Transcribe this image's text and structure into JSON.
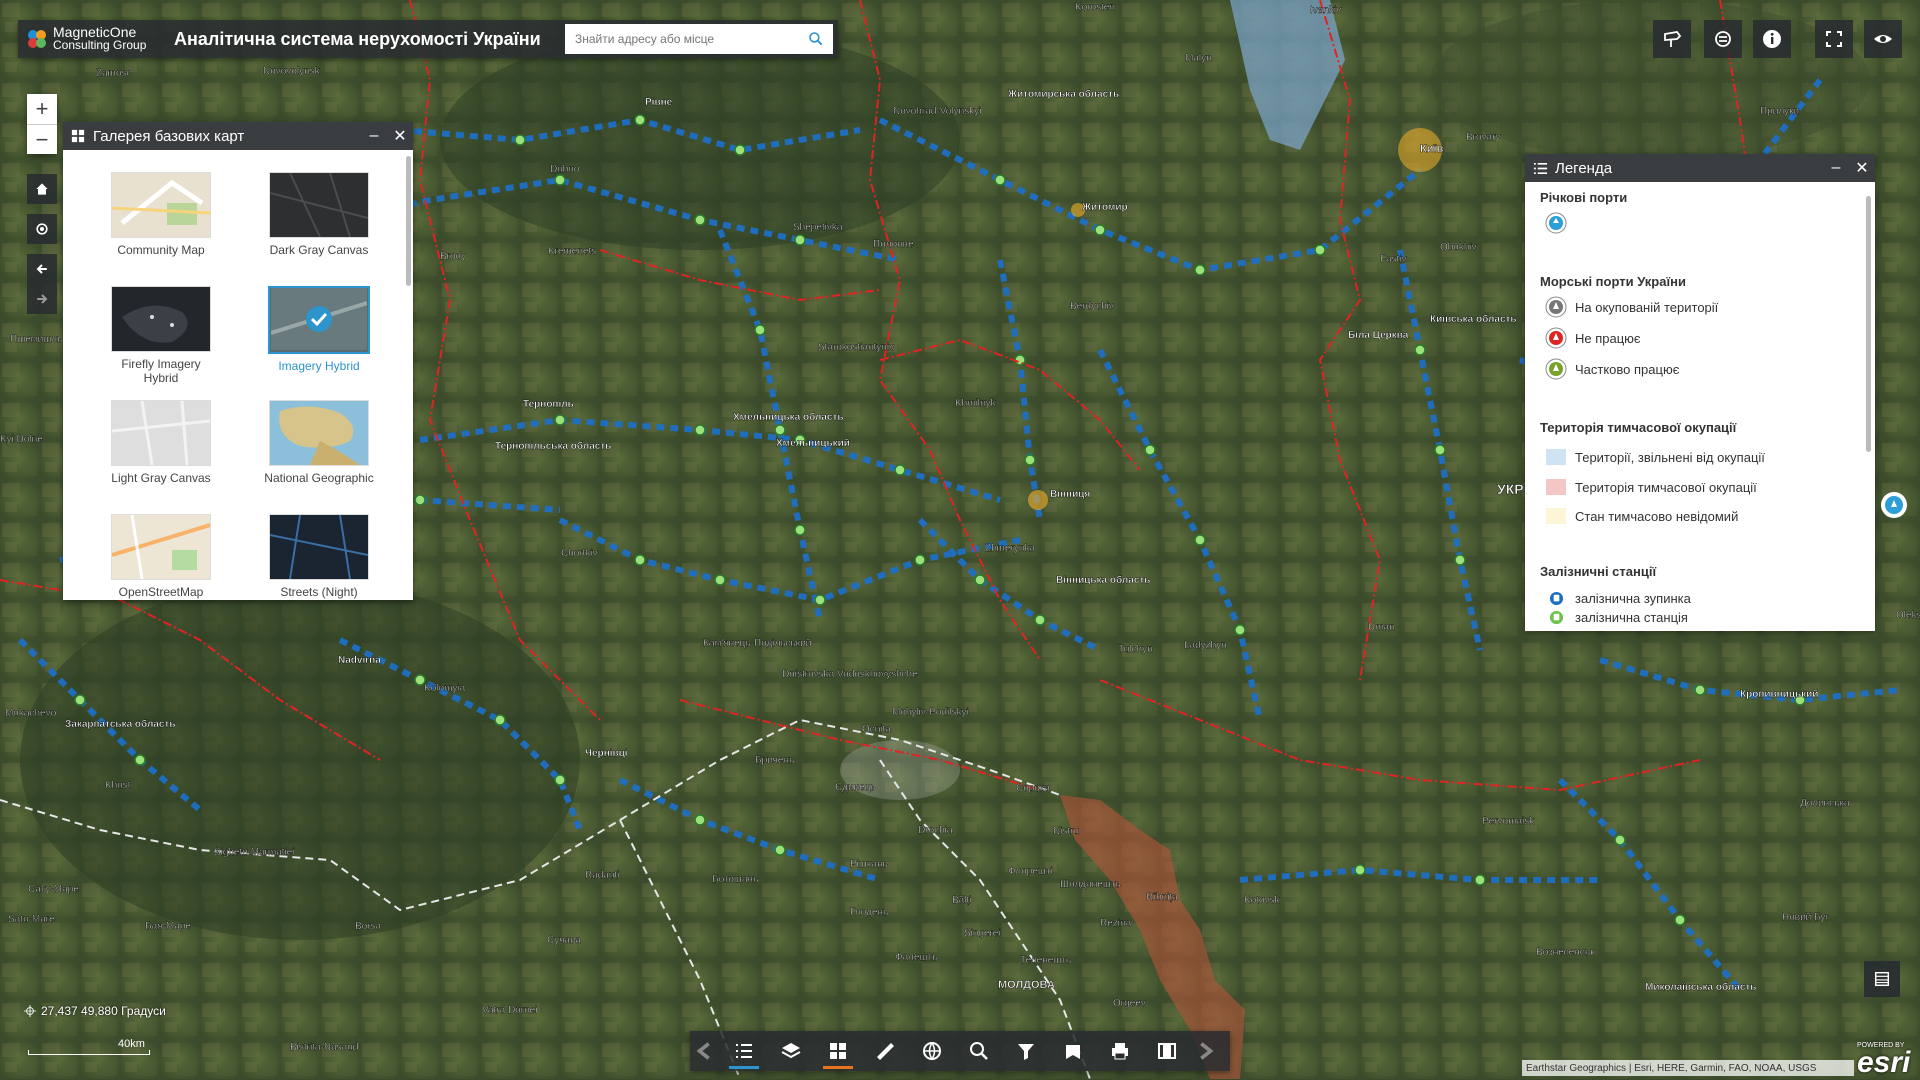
{
  "header": {
    "logo_line1": "MagneticOne",
    "logo_line2": "Consulting Group",
    "title": "Аналітична система нерухомості України",
    "search_placeholder": "Знайти адресу або місце"
  },
  "map": {
    "labels": [
      {
        "text": "Zamosc"
      },
      {
        "text": "Novovolynsk"
      },
      {
        "text": "Korosten"
      },
      {
        "text": "Ivankiv"
      },
      {
        "text": "Malyn"
      },
      {
        "text": "Рівне"
      },
      {
        "text": "Novohrad-Volynskyi"
      },
      {
        "text": "Житомирська область"
      },
      {
        "text": "Київ"
      },
      {
        "text": "Brovary"
      },
      {
        "text": "Прилуки"
      },
      {
        "text": "Dubno"
      },
      {
        "text": "Shepetivka"
      },
      {
        "text": "Житомир"
      },
      {
        "text": "Kremenets"
      },
      {
        "text": "Полонне"
      },
      {
        "text": "Brody"
      },
      {
        "text": "Fastiv"
      },
      {
        "text": "Obukhiv"
      },
      {
        "text": "Berdychiv"
      },
      {
        "text": "Starokostiantyniv"
      },
      {
        "text": "Біла Церква"
      },
      {
        "text": "Київська область"
      },
      {
        "text": "Тернопіль"
      },
      {
        "text": "Khmilnyk"
      },
      {
        "text": "Хмельницька область"
      },
      {
        "text": "Хмельницький"
      },
      {
        "text": "Тернопільська область"
      },
      {
        "text": "Вінниця"
      },
      {
        "text": "Zhmerynka"
      },
      {
        "text": "Chortkiv"
      },
      {
        "text": "Вінницька область"
      },
      {
        "text": "Кам'янець-Подільський"
      },
      {
        "text": "Tulchyn"
      },
      {
        "text": "Ladyzhyn"
      },
      {
        "text": "Uman"
      },
      {
        "text": "Dnistrovska Vodoskhovyshche"
      },
      {
        "text": "Nadvirna"
      },
      {
        "text": "Kolomyia"
      },
      {
        "text": "Mukachevo"
      },
      {
        "text": "Закарпатська область"
      },
      {
        "text": "Чернівці"
      },
      {
        "text": "Mohyliv-Podilskyi"
      },
      {
        "text": "Ocnita"
      },
      {
        "text": "Бричень"
      },
      {
        "text": "Єдинець"
      },
      {
        "text": "Сорока"
      },
      {
        "text": "Khust"
      },
      {
        "text": "Sighetu Marmatiei"
      },
      {
        "text": "Drochia"
      },
      {
        "text": "Рішкань"
      },
      {
        "text": "Ботошань"
      },
      {
        "text": "Глодень"
      },
      {
        "text": "Флорешті"
      },
      {
        "text": "Шолданешть"
      },
      {
        "text": "Rîbnița"
      },
      {
        "text": "Kotovsk"
      },
      {
        "text": "Pervomaisk"
      },
      {
        "text": "Кропивницький"
      },
      {
        "text": "Долинська"
      },
      {
        "text": "Сату-Маре"
      },
      {
        "text": "Satu-Mare"
      },
      {
        "text": "Бая-Маре"
      },
      {
        "text": "Borsa"
      },
      {
        "text": "Radauti"
      },
      {
        "text": "Сучава"
      },
      {
        "text": "Bălți"
      },
      {
        "text": "Фалешть"
      },
      {
        "text": "Singerei"
      },
      {
        "text": "Теленешть"
      },
      {
        "text": "Rezina"
      },
      {
        "text": "МОЛДОВА"
      },
      {
        "text": "Vatra Dornei"
      },
      {
        "text": "Bistrita-Nasaud"
      },
      {
        "text": "Вознесенськ"
      },
      {
        "text": "Миколаївська область"
      },
      {
        "text": "Новий Буг"
      },
      {
        "text": "Oleks"
      },
      {
        "text": "УКР"
      },
      {
        "text": "Пшемишль"
      },
      {
        "text": "Kyi Dolne"
      },
      {
        "text": "Nistru"
      },
      {
        "text": "Orgeev"
      },
      {
        "text": "Сучава"
      }
    ]
  },
  "gallery": {
    "title": "Галерея базових карт",
    "items": [
      {
        "label": "Community Map",
        "selected": false
      },
      {
        "label": "Dark Gray Canvas",
        "selected": false
      },
      {
        "label": "Firefly Imagery Hybrid",
        "selected": false
      },
      {
        "label": "Imagery Hybrid",
        "selected": true
      },
      {
        "label": "Light Gray Canvas",
        "selected": false
      },
      {
        "label": "National Geographic",
        "selected": false
      },
      {
        "label": "OpenStreetMap",
        "selected": false
      },
      {
        "label": "Streets (Night)",
        "selected": false
      }
    ]
  },
  "legend": {
    "title": "Легенда",
    "sections": [
      {
        "heading": "Річкові порти",
        "items": [
          {
            "label": "",
            "color": "#2d9fd8"
          }
        ]
      },
      {
        "heading": "Морські порти України",
        "items": [
          {
            "label": "На окупованій території",
            "color": "#777777"
          },
          {
            "label": "Не працює",
            "color": "#e02424"
          },
          {
            "label": "Частково працює",
            "color": "#7aa22a"
          }
        ]
      },
      {
        "heading": "Територія тимчасової окупації",
        "items": [
          {
            "label": "Території, звільнені від окупації",
            "color": "#cfe3f5"
          },
          {
            "label": "Територія тимчасової окупації",
            "color": "#f5c6c6"
          },
          {
            "label": "Стан тимчасово невідомий",
            "color": "#fbf6d6"
          }
        ]
      },
      {
        "heading": "Залізничні станції",
        "items": [
          {
            "label": "залізнична зупинка",
            "color": "#1e6fc4"
          },
          {
            "label": "залізнична станція",
            "color": "#6cc24a"
          }
        ]
      }
    ]
  },
  "status": {
    "coordinates": "27,437 49,880 Градуси",
    "scale": "40km",
    "attribution": "Earthstar Geographics | Esri, HERE, Garmin, FAO, NOAA, USGS",
    "esri_powered": "POWERED BY",
    "esri_logo": "esri"
  },
  "toolbar": {
    "items": [
      "legend",
      "layers",
      "basemap-gallery",
      "measure",
      "directions",
      "query",
      "filter",
      "bookmark",
      "print",
      "swipe"
    ]
  },
  "colors": {
    "panel_dark": "#282c30",
    "accent": "#2d94cc",
    "rail_stop": "#1e6fc4",
    "rail_station": "#6cc24a",
    "boundary": "#e02424"
  }
}
